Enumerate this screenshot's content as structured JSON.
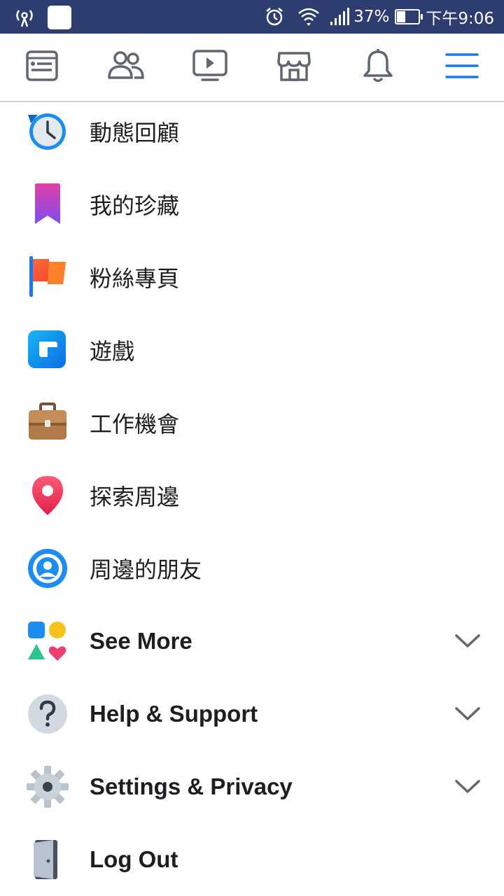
{
  "status_bar": {
    "battery_percent": "37%",
    "battery_level": 0.37,
    "time": "下午9:06",
    "icons": [
      "wireless-tether-icon",
      "notification-app-icon",
      "alarm-icon",
      "wifi-icon",
      "signal-icon",
      "battery-icon"
    ]
  },
  "top_nav": {
    "tabs": [
      {
        "name": "news-feed",
        "icon": "news-feed-icon"
      },
      {
        "name": "friends",
        "icon": "friends-icon"
      },
      {
        "name": "watch",
        "icon": "watch-video-icon"
      },
      {
        "name": "marketplace",
        "icon": "marketplace-store-icon"
      },
      {
        "name": "notifications",
        "icon": "bell-icon"
      },
      {
        "name": "menu",
        "icon": "hamburger-menu-icon",
        "active": true
      }
    ],
    "active_color": "#1877f2"
  },
  "menu": {
    "items": [
      {
        "label": "動態回顧",
        "icon": "memories-clock-icon"
      },
      {
        "label": "我的珍藏",
        "icon": "saved-bookmark-icon"
      },
      {
        "label": "粉絲專頁",
        "icon": "pages-flag-icon"
      },
      {
        "label": "遊戲",
        "icon": "gaming-icon"
      },
      {
        "label": "工作機會",
        "icon": "jobs-briefcase-icon"
      },
      {
        "label": "探索周邊",
        "icon": "location-pin-icon"
      },
      {
        "label": "周邊的朋友",
        "icon": "nearby-friends-icon"
      },
      {
        "label": "See More",
        "icon": "see-more-shapes-icon",
        "expandable": true
      },
      {
        "label": "Help & Support",
        "icon": "help-question-icon",
        "expandable": true
      },
      {
        "label": "Settings & Privacy",
        "icon": "settings-gear-icon",
        "expandable": true
      },
      {
        "label": "Log Out",
        "icon": "logout-door-icon"
      }
    ]
  }
}
